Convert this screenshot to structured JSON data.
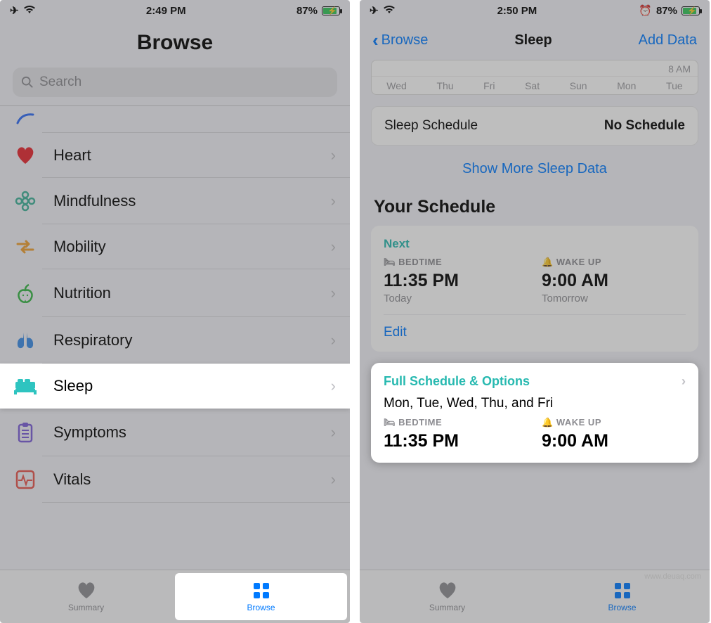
{
  "screen1": {
    "status": {
      "time": "2:49 PM",
      "battery": "87%"
    },
    "title": "Browse",
    "search_placeholder": "Search",
    "cats": [
      {
        "name": "Heart"
      },
      {
        "name": "Mindfulness"
      },
      {
        "name": "Mobility"
      },
      {
        "name": "Nutrition"
      },
      {
        "name": "Respiratory"
      },
      {
        "name": "Sleep",
        "highlight": true
      },
      {
        "name": "Symptoms"
      },
      {
        "name": "Vitals"
      }
    ],
    "tabs": {
      "summary": "Summary",
      "browse": "Browse"
    }
  },
  "screen2": {
    "status": {
      "time": "2:50 PM",
      "battery": "87%"
    },
    "nav": {
      "back": "Browse",
      "title": "Sleep",
      "action": "Add Data"
    },
    "chart": {
      "mark": "8 AM",
      "days": [
        "Wed",
        "Thu",
        "Fri",
        "Sat",
        "Sun",
        "Mon",
        "Tue"
      ]
    },
    "sched_row": {
      "label": "Sleep Schedule",
      "value": "No Schedule"
    },
    "show_more": "Show More Sleep Data",
    "section": "Your Schedule",
    "next_card": {
      "next": "Next",
      "bed_label": "BEDTIME",
      "bed_time": "11:35 PM",
      "bed_sub": "Today",
      "wake_label": "WAKE UP",
      "wake_time": "9:00 AM",
      "wake_sub": "Tomorrow",
      "edit": "Edit"
    },
    "full_card": {
      "title": "Full Schedule & Options",
      "days": "Mon, Tue, Wed, Thu, and Fri",
      "bed_label": "BEDTIME",
      "bed_time": "11:35 PM",
      "wake_label": "WAKE UP",
      "wake_time": "9:00 AM"
    },
    "tabs": {
      "summary": "Summary",
      "browse": "Browse"
    }
  },
  "watermark": "www.deuaq.com"
}
